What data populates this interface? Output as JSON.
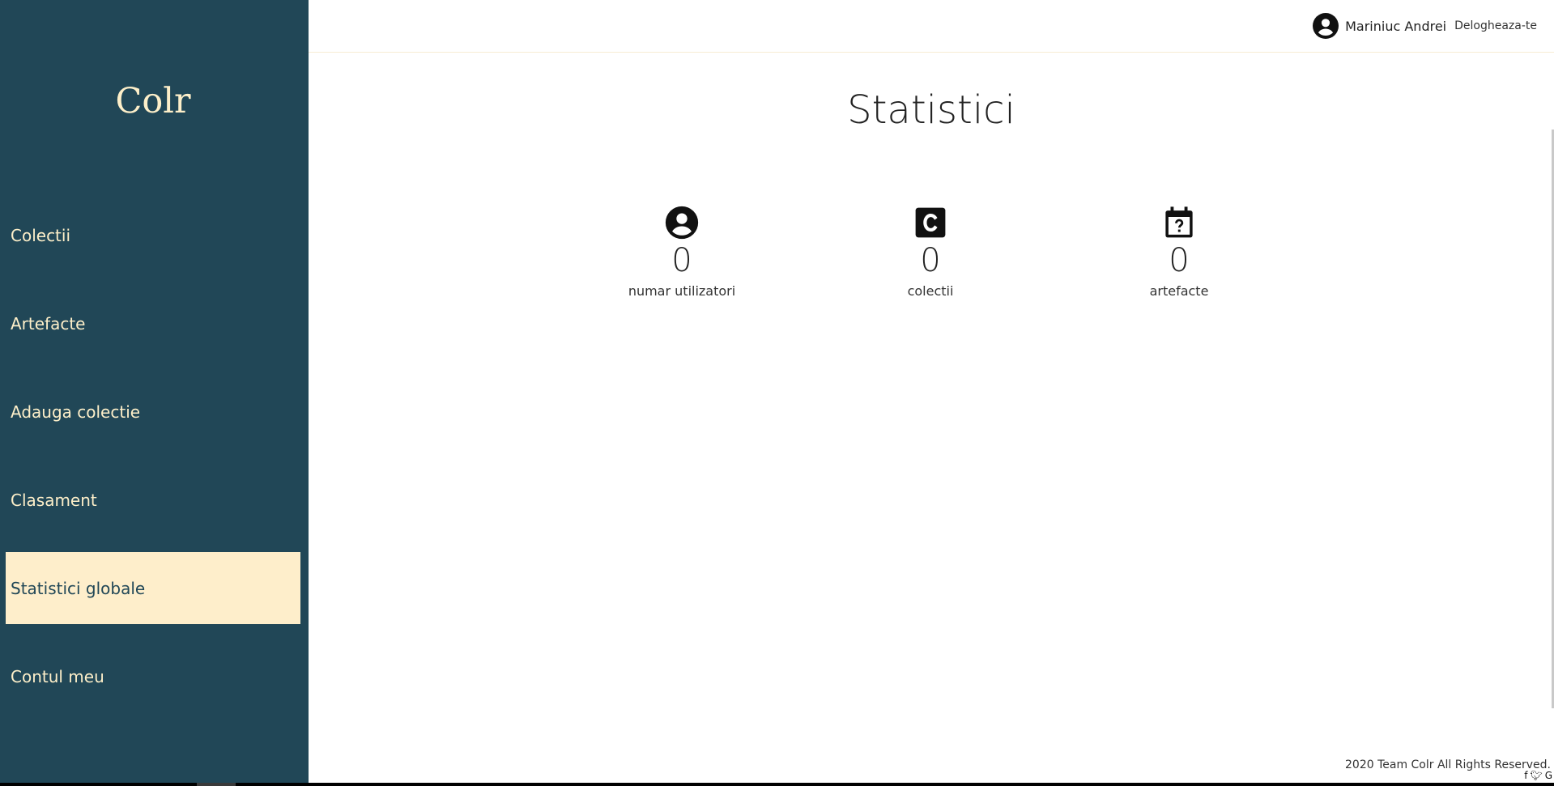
{
  "brand": {
    "name": "Colr",
    "color": "#fdefc9",
    "sidebar_bg": "#214757",
    "active_bg": "#feeecb"
  },
  "sidebar": {
    "items": [
      {
        "label": "Colectii",
        "active": false
      },
      {
        "label": "Artefacte",
        "active": false
      },
      {
        "label": "Adauga colectie",
        "active": false
      },
      {
        "label": "Clasament",
        "active": false
      },
      {
        "label": "Statistici globale",
        "active": true
      },
      {
        "label": "Contul meu",
        "active": false
      }
    ]
  },
  "header": {
    "user_icon": "account-circle-icon",
    "user_name": "Mariniuc Andrei",
    "logout_label": "Delogheaza-te"
  },
  "main": {
    "title": "Statistici",
    "stats": [
      {
        "icon": "account-circle-icon",
        "value": "0",
        "label": "numar utilizatori"
      },
      {
        "icon": "letter-c-box-icon",
        "value": "0",
        "label": "colectii"
      },
      {
        "icon": "calendar-question-icon",
        "value": "0",
        "label": "artefacte"
      }
    ]
  },
  "footer": {
    "text": "2020 Team Colr All Rights Reserved.",
    "social_icons": [
      "facebook-icon",
      "twitter-icon",
      "google-icon"
    ]
  }
}
